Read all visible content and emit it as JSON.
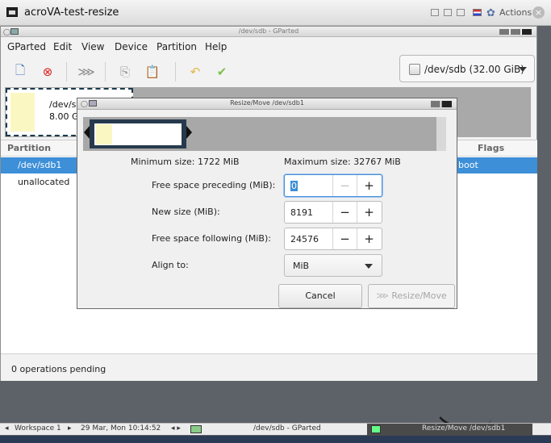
{
  "outer_window": {
    "title": "acroVA-test-resize",
    "actions_label": "Actions"
  },
  "gparted": {
    "window_title": "/dev/sdb - GParted",
    "menu": [
      "GParted",
      "Edit",
      "View",
      "Device",
      "Partition",
      "Help"
    ],
    "device_selector": "/dev/sdb (32.00 GiB)",
    "partition_map": {
      "partition_name": "/dev/sd",
      "partition_size": "8.00 G"
    },
    "list_header": {
      "partition": "Partition",
      "flags": "Flags"
    },
    "rows": [
      {
        "partition": "/dev/sdb1",
        "flags": "boot",
        "selected": true
      },
      {
        "partition": "unallocated",
        "flags": "",
        "selected": false
      }
    ],
    "status": "0 operations pending"
  },
  "dialog": {
    "title": "Resize/Move /dev/sdb1",
    "min_size": "Minimum size: 1722 MiB",
    "max_size": "Maximum size: 32767 MiB",
    "fields": {
      "preceding": {
        "label": "Free space preceding (MiB):",
        "value": "0"
      },
      "new_size": {
        "label": "New size (MiB):",
        "value": "8191"
      },
      "following": {
        "label": "Free space following (MiB):",
        "value": "24576"
      },
      "align": {
        "label": "Align to:",
        "value": "MiB"
      }
    },
    "cancel_label": "Cancel",
    "resize_label": "Resize/Move"
  },
  "taskbar": {
    "workspace": "Workspace 1",
    "datetime": "29 Mar, Mon 10:14:52",
    "task1": "/dev/sdb - GParted",
    "task2": "Resize/Move /dev/sdb1"
  }
}
